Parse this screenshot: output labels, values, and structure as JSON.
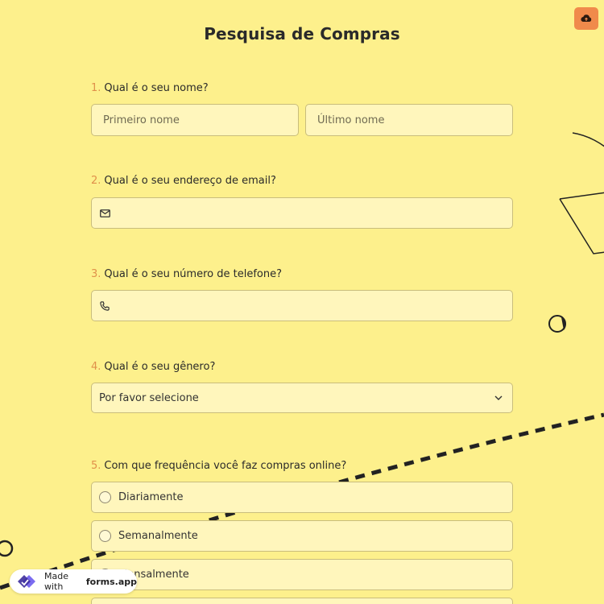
{
  "form": {
    "title": "Pesquisa de Compras"
  },
  "questions": [
    {
      "number": "1.",
      "label": "Qual é o seu nome?",
      "first_placeholder": "Primeiro nome",
      "last_placeholder": "Último nome"
    },
    {
      "number": "2.",
      "label": "Qual é o seu endereço de email?",
      "icon": "mail-icon"
    },
    {
      "number": "3.",
      "label": "Qual é o seu número de telefone?",
      "icon": "phone-icon"
    },
    {
      "number": "4.",
      "label": "Qual é o seu gênero?",
      "selected": "Por favor selecione"
    },
    {
      "number": "5.",
      "label": "Com que frequência você faz compras online?",
      "options": [
        "Diariamente",
        "Semanalmente",
        "Mensalmente"
      ]
    }
  ],
  "badge": {
    "prefix": "Made with",
    "brand": "forms.app"
  },
  "colors": {
    "background": "#fdf08c",
    "field_bg": "#fff6bc",
    "accent": "#f08a4b",
    "number": "#e0904a"
  }
}
